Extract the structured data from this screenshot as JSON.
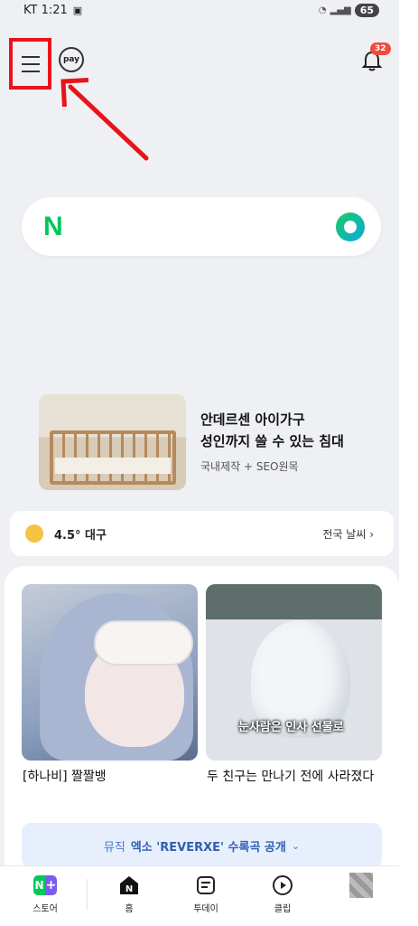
{
  "status_bar": {
    "carrier_time": "KT 1:21",
    "battery": "65"
  },
  "top_bar": {
    "pay_label": "pay",
    "notification_count": "32"
  },
  "search": {
    "logo": "N"
  },
  "ad": {
    "title_line1": "안데르센 아이가구",
    "title_line2": "성인까지 쓸 수 있는 침대",
    "subtitle": "국내제작 + SEO원목"
  },
  "weather": {
    "summary": "4.5° 대구",
    "link": "전국 날씨 ›"
  },
  "cards": [
    {
      "title": "[하나비] 짤짤뱅"
    },
    {
      "title": "두 친구는 만나기 전에 사라졌다",
      "caption": "눈사람은 인사 선물로"
    }
  ],
  "music_banner": {
    "category": "뮤직",
    "text": "엑소 'REVERXE' 수록곡 공개",
    "chevron": "⌄"
  },
  "bottom_nav": {
    "store": {
      "label": "스토어",
      "icon_left": "N",
      "icon_right": "+"
    },
    "home": {
      "label": "홈",
      "icon_text": "N"
    },
    "today": {
      "label": "투데이"
    },
    "clip": {
      "label": "클립"
    }
  },
  "colors": {
    "highlight_red": "#e8141a",
    "naver_green": "#03c75a",
    "badge_red": "#ef4b3c"
  }
}
